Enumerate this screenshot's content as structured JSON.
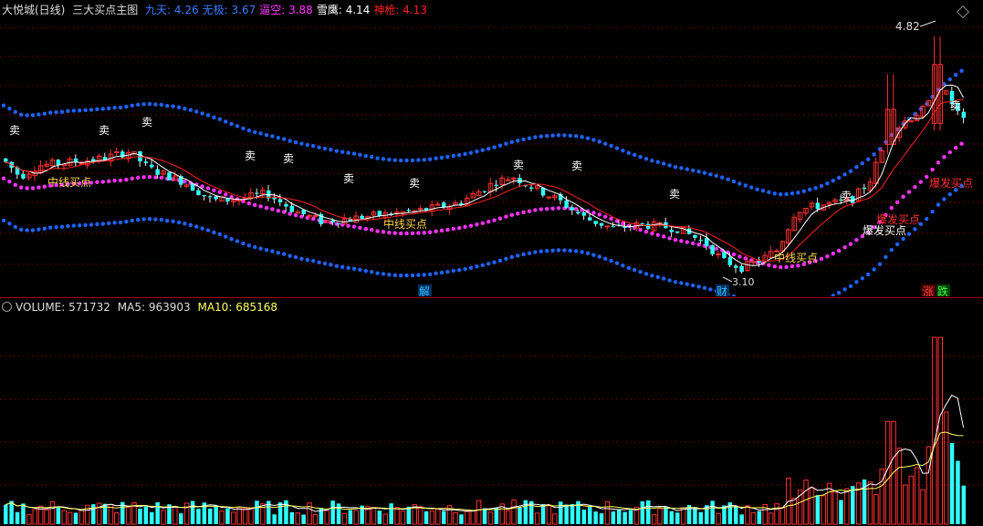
{
  "header": {
    "stock": "大悦城(日线)",
    "indicator": "三大买点主图",
    "fields": [
      {
        "label": "九天:",
        "value": "4.26",
        "color": "#3a7dff"
      },
      {
        "label": "无极:",
        "value": "3.67",
        "color": "#3a7dff"
      },
      {
        "label": "逼空:",
        "value": "3.88",
        "color": "#ff33ff"
      },
      {
        "label": "雪鹰:",
        "value": "4.14",
        "color": "#ffffff"
      },
      {
        "label": "神枪:",
        "value": "4.13",
        "color": "#ff2020"
      }
    ]
  },
  "volume_header": {
    "label": "VOLUME:",
    "value": "571732",
    "ma5_label": "MA5:",
    "ma5_value": "963903",
    "ma10_label": "MA10:",
    "ma10_value": "685168"
  },
  "annotations": {
    "high_price": "4.82",
    "low_price": "3.10",
    "sell": "卖",
    "mid_buy": "中线买点",
    "burst_buy": "爆发买点",
    "jie": "解",
    "cai": "财",
    "zhang": "涨",
    "die": "跌"
  },
  "colors": {
    "up": "#ff3030",
    "down": "#30ffff",
    "blue_band": "#1e64ff",
    "magenta_band": "#ff33ff",
    "white_ma": "#ffffff",
    "red_ma": "#ff2020",
    "ma10_vol": "#ffff60"
  },
  "chart_data": {
    "type": "candlestick",
    "price_range": [
      3.0,
      4.95
    ],
    "y_ticks": [
      3.2,
      3.4,
      3.6,
      3.8,
      4.0,
      4.2,
      4.4,
      4.6,
      4.8
    ],
    "highest": 4.82,
    "lowest": 3.1
  }
}
